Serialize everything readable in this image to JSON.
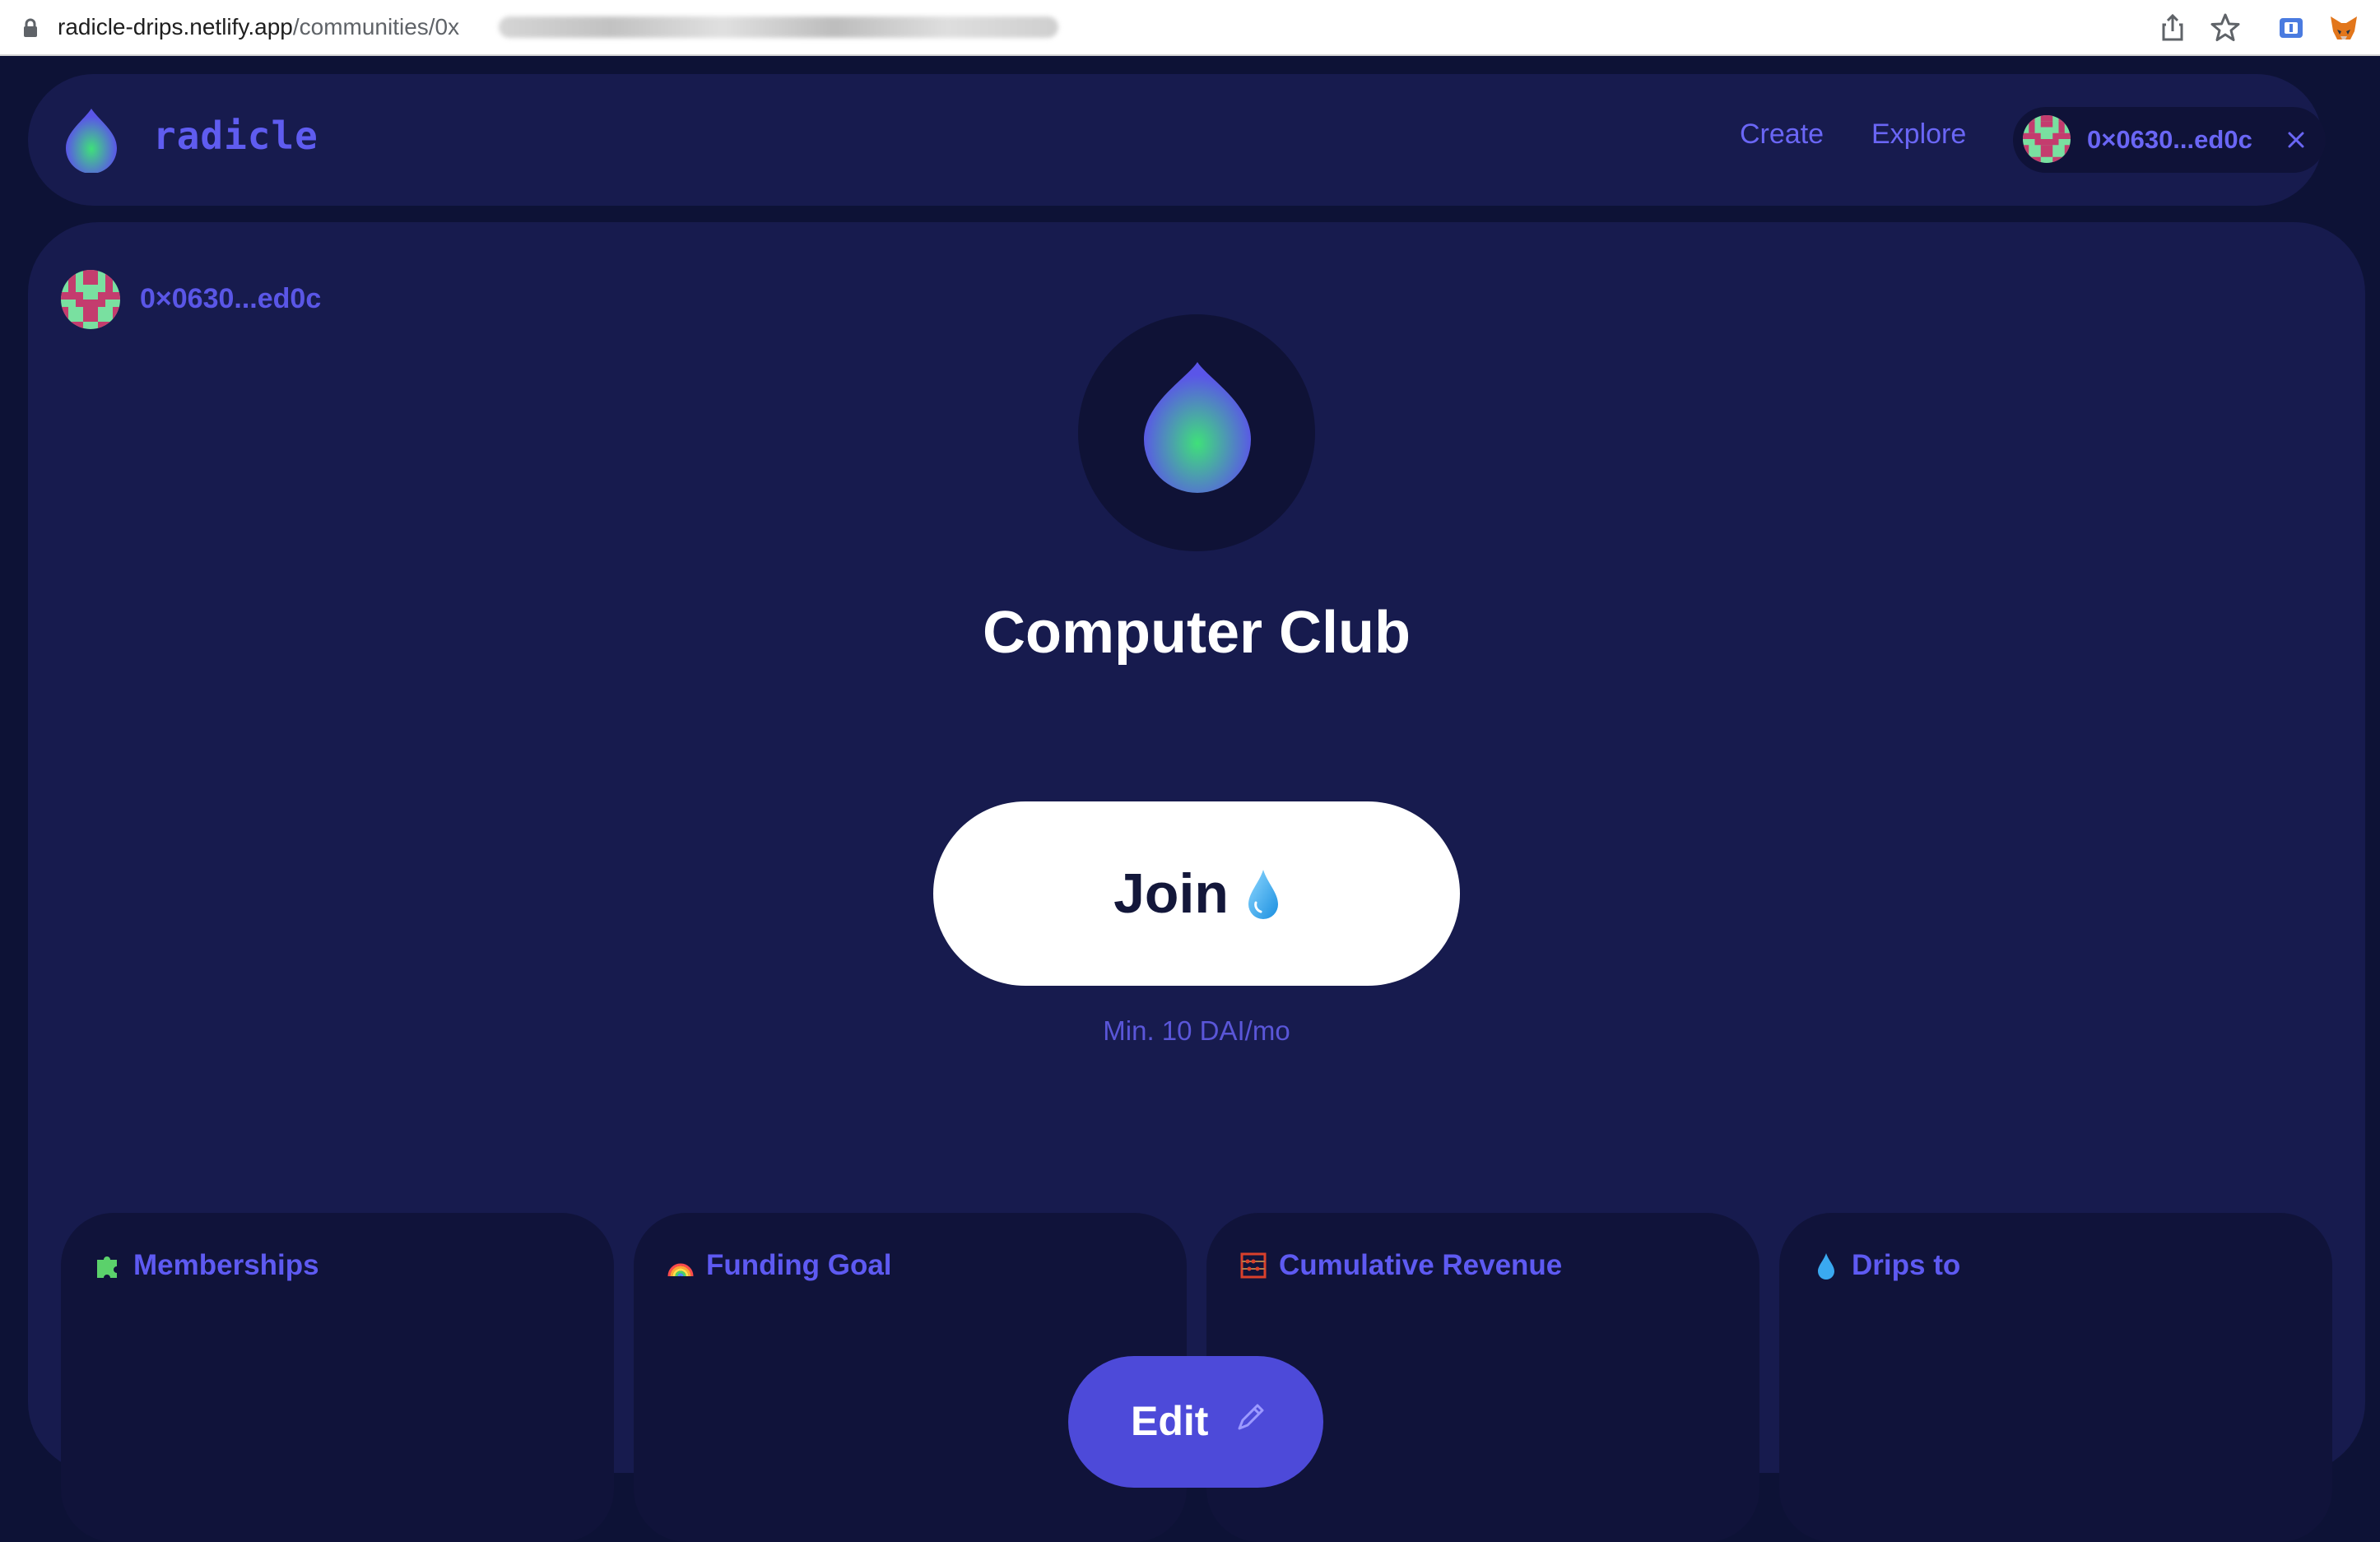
{
  "browser": {
    "url_host": "radicle-drips.netlify.app",
    "url_path": "/communities/0x"
  },
  "nav": {
    "brand": "radicle",
    "links": [
      "Create",
      "Explore"
    ],
    "wallet_address": "0×0630...ed0c",
    "close_icon": "close-icon"
  },
  "community": {
    "owner_address": "0×0630...ed0c",
    "title": "Computer Club",
    "join_label": "Join",
    "min_note": "Min. 10 DAI/mo",
    "edit_label": "Edit"
  },
  "stats": [
    {
      "icon": "puzzle-icon",
      "label": "Memberships"
    },
    {
      "icon": "rainbow-icon",
      "label": "Funding Goal"
    },
    {
      "icon": "abacus-icon",
      "label": "Cumulative Revenue"
    },
    {
      "icon": "droplet-icon",
      "label": "Drips to"
    }
  ],
  "colors": {
    "page_bg": "#0d1236",
    "card_bg": "#171b4e",
    "accent": "#5f5cf0",
    "button_bg": "#4d4ad9"
  }
}
